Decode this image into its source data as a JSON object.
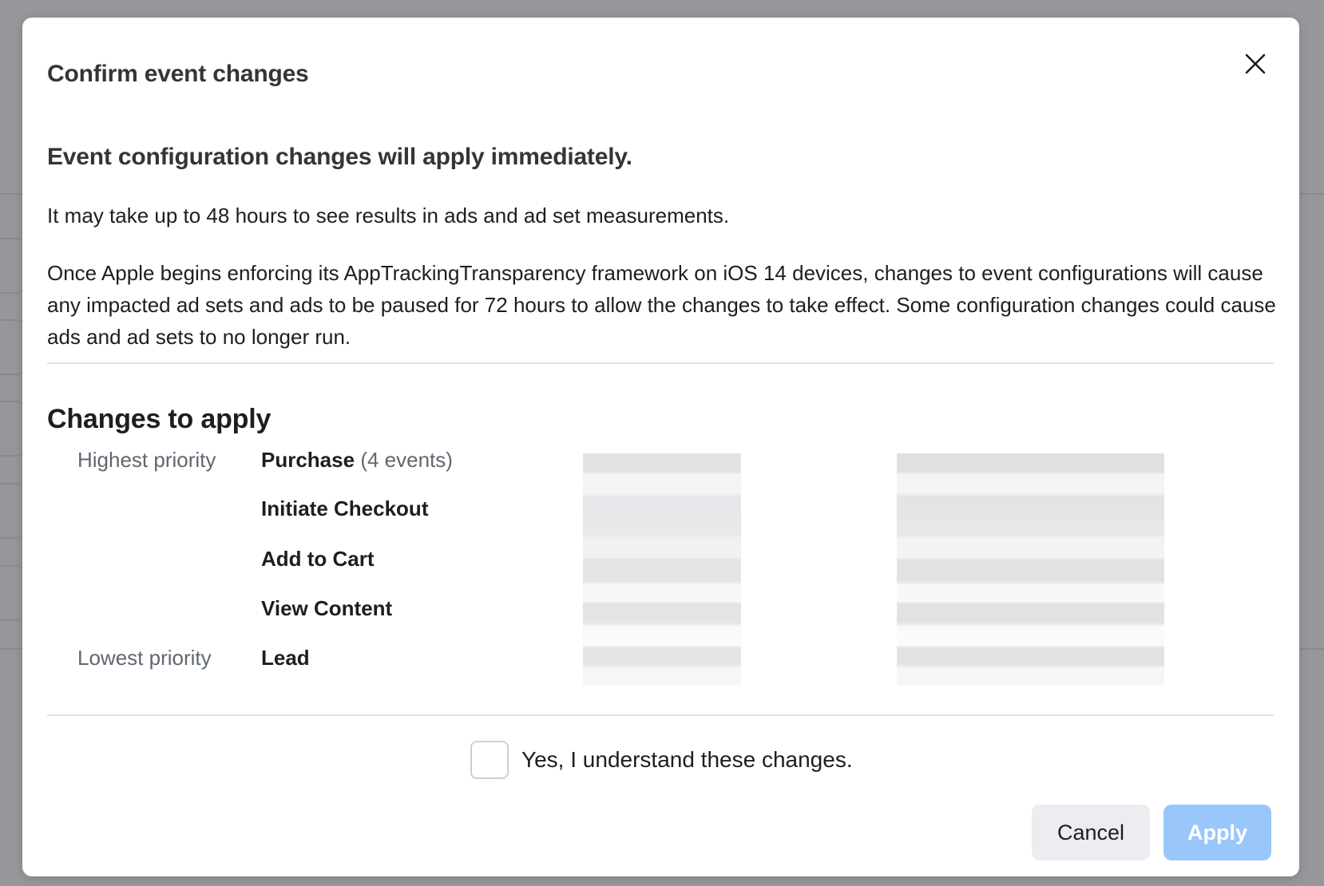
{
  "dialog": {
    "title": "Confirm event changes",
    "heading": "Event configuration changes will apply immediately.",
    "paragraph_1": "It may take up to 48 hours to see results in ads and ad set measurements.",
    "paragraph_2": "Once Apple begins enforcing its AppTrackingTransparency framework on iOS 14 devices, changes to event configurations will cause any impacted ad sets and ads to be paused for 72 hours to allow the changes to take effect. Some configuration changes could cause ads and ad sets to no longer run.",
    "changes_title": "Changes to apply",
    "events": [
      {
        "priority_label": "Highest priority",
        "name": "Purchase",
        "count": "(4 events)"
      },
      {
        "priority_label": "",
        "name": "Initiate Checkout",
        "count": ""
      },
      {
        "priority_label": "",
        "name": "Add to Cart",
        "count": ""
      },
      {
        "priority_label": "",
        "name": "View Content",
        "count": ""
      },
      {
        "priority_label": "Lowest priority",
        "name": "Lead",
        "count": ""
      }
    ],
    "confirm_label": "Yes, I understand these changes.",
    "confirm_checked": false,
    "cancel_label": "Cancel",
    "apply_label": "Apply"
  },
  "colors": {
    "overlay": "#97979b",
    "apply_disabled": "#99c7fb",
    "cancel_bg": "#ebedf0",
    "text_primary": "#1c1e21",
    "text_secondary": "#606770"
  },
  "icons": {
    "close": "close-icon"
  }
}
